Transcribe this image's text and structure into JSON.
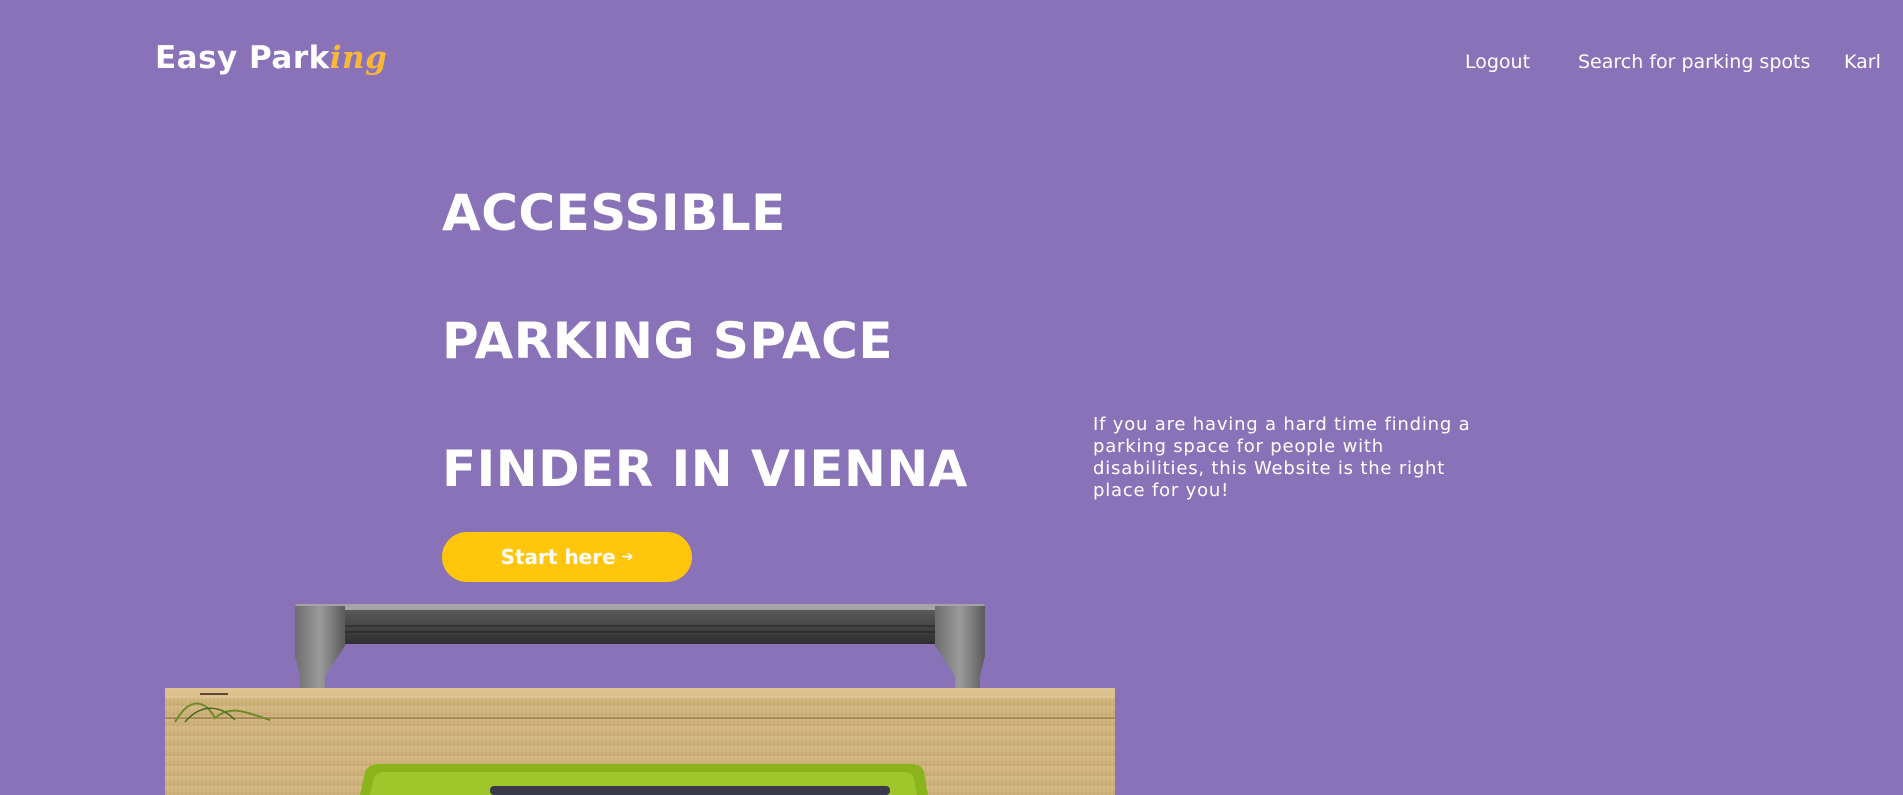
{
  "brand": {
    "name_main": "Easy Park",
    "name_accent": "ing",
    "accent_color": "#f9b73a"
  },
  "nav": {
    "logout": "Logout",
    "search": "Search for parking spots",
    "user": "Karl"
  },
  "hero": {
    "line1": "ACCESSIBLE",
    "line2": "PARKING SPACE",
    "line3": "FINDER IN VIENNA",
    "cta_label": "Start here",
    "cta_icon": "arrow-right-icon",
    "description": "If you are having a hard time finding a parking space for people with disabilities, this Website is the right place for you!"
  },
  "colors": {
    "background": "#8a72b9",
    "cta": "#ffc60b"
  }
}
